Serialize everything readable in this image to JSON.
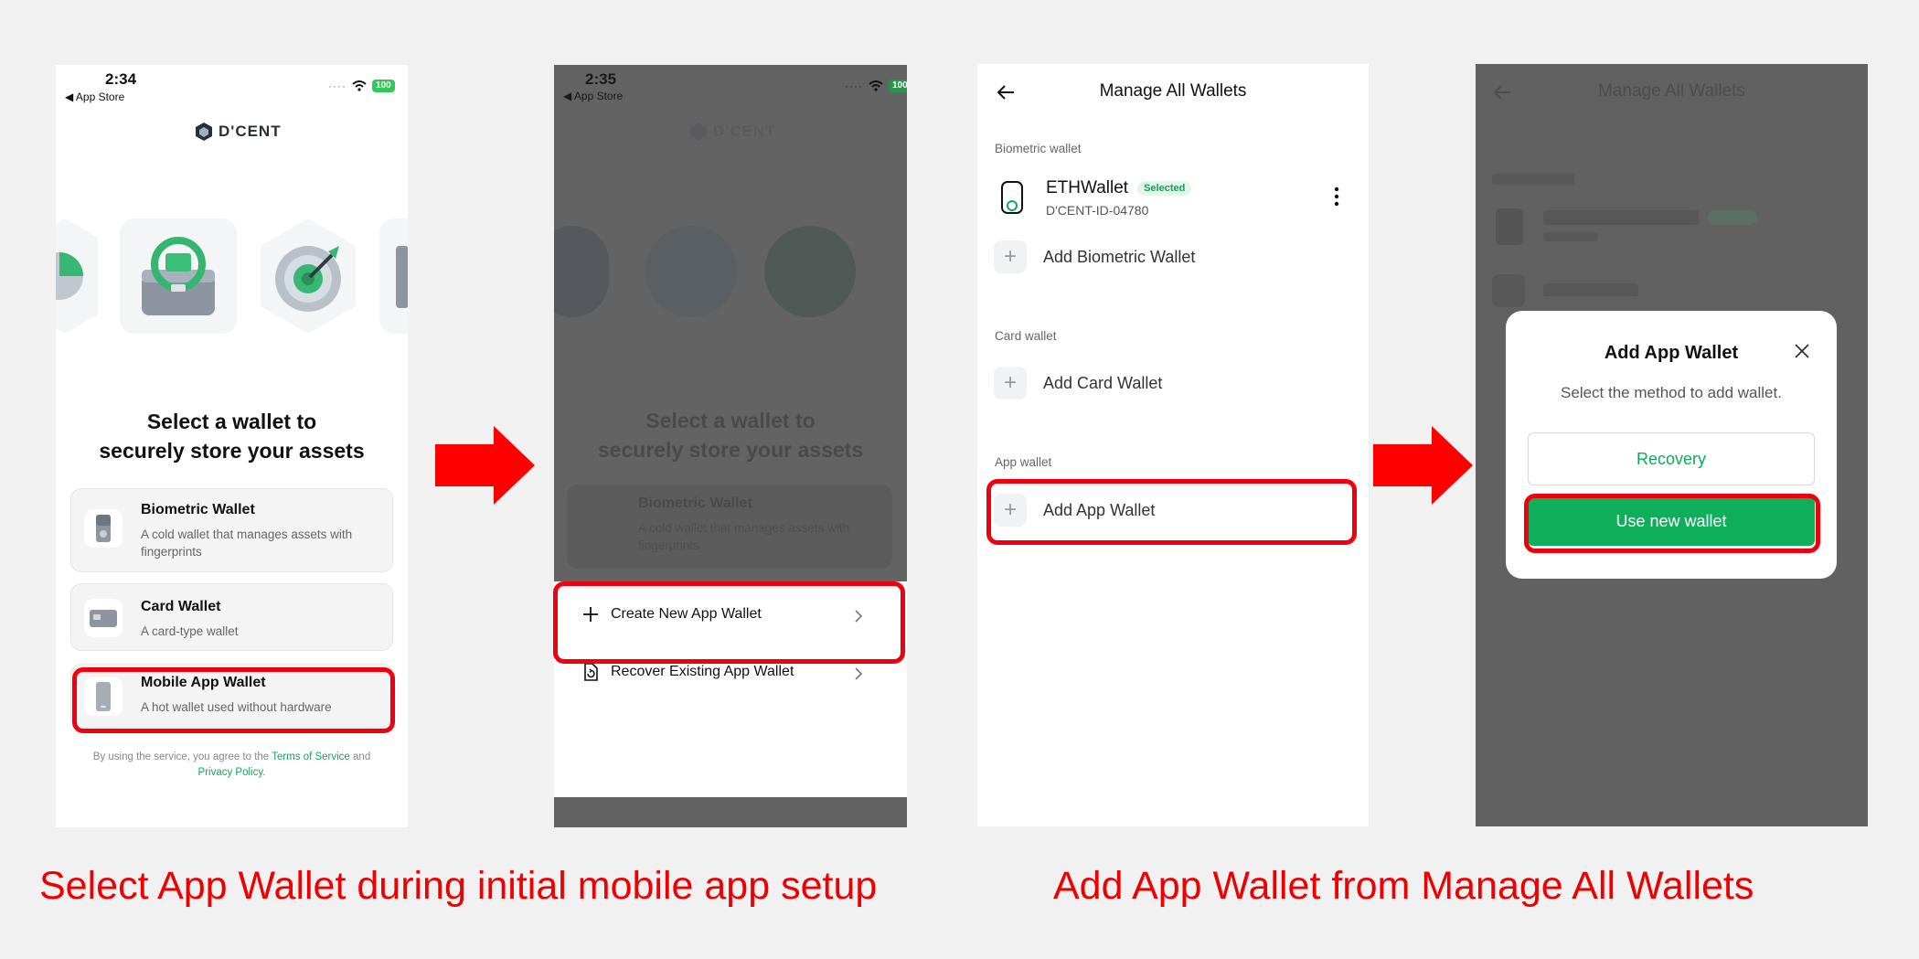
{
  "captions": {
    "left": "Select App Wallet during initial mobile app setup",
    "right": "Add App Wallet from Manage All Wallets"
  },
  "panel1": {
    "status_time": "2:34",
    "status_back": "◀ App Store",
    "battery": "100",
    "logo_text": "D'CENT",
    "title_line1": "Select a wallet to",
    "title_line2": "securely store your assets",
    "options": [
      {
        "title": "Biometric Wallet",
        "desc": "A cold wallet that manages assets with fingerprints"
      },
      {
        "title": "Card Wallet",
        "desc": "A card-type wallet"
      },
      {
        "title": "Mobile App Wallet",
        "desc": "A hot wallet used without hardware"
      }
    ],
    "terms_prefix": "By using the service, you agree to the ",
    "terms_link": "Terms of Service",
    "terms_and": " and ",
    "privacy_link": "Privacy Policy",
    "terms_end": "."
  },
  "panel2": {
    "status_time": "2:35",
    "status_back": "◀ App Store",
    "battery": "100",
    "logo_text": "D'CENT",
    "title_line1": "Select a wallet to",
    "title_line2": "securely store your assets",
    "bg_option_title": "Biometric Wallet",
    "bg_option_desc": "A cold wallet that manages assets with fingerprints",
    "create_label": "Create New App Wallet",
    "recover_label": "Recover Existing App Wallet"
  },
  "panel3": {
    "header": "Manage All Wallets",
    "sections": {
      "biometric": "Biometric wallet",
      "card": "Card wallet",
      "app": "App wallet"
    },
    "wallet_name": "ETHWallet",
    "wallet_badge": "Selected",
    "wallet_id": "D'CENT-ID-04780",
    "add_biometric": "Add Biometric Wallet",
    "add_card": "Add Card Wallet",
    "add_app": "Add App Wallet"
  },
  "panel4": {
    "bg_header": "Manage All Wallets",
    "modal_title": "Add App Wallet",
    "modal_subtitle": "Select the method to add wallet.",
    "recovery_label": "Recovery",
    "new_wallet_label": "Use new wallet"
  },
  "colors": {
    "highlight": "#f0000f",
    "accent_green": "#0fae5b",
    "caption_red": "#ee0000"
  }
}
